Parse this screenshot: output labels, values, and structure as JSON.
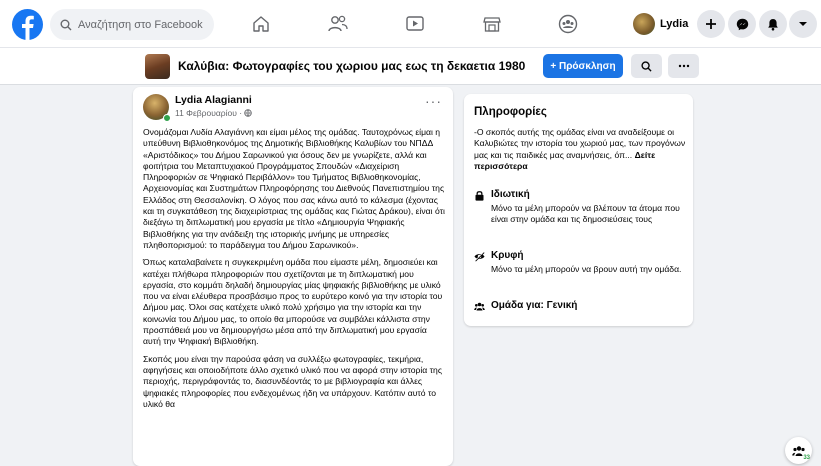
{
  "topbar": {
    "logo": "facebook-logo",
    "search_placeholder": "Αναζήτηση στο Facebook",
    "nav_icons": [
      "home-icon",
      "friends-icon",
      "watch-icon",
      "marketplace-icon",
      "groups-icon"
    ],
    "profile_name": "Lydia",
    "right_icons": [
      "plus-icon",
      "messenger-icon",
      "notifications-icon",
      "account-menu-icon"
    ]
  },
  "group": {
    "title": "Καλύβια: Φωτογραφίες του χωριου μας εως τη δεκαετια 1980",
    "invite_label": "+ Πρόσκληση"
  },
  "post": {
    "author": "Lydia Alagianni",
    "date": "11 Φεβρουαρίου · ",
    "paragraphs": [
      "Ονομάζομαι Λυδία Αλαγιάννη και είμαι μέλος της ομάδας. Ταυτοχρόνως είμαι η υπεύθυνη Βιβλιοθηκονόμος της Δημοτικής Βιβλιοθήκης Καλυβίων του ΝΠΔΔ «Αριστόδικος» του Δήμου Σαρωνικού για όσους δεν με γνωρίζετε, αλλά και φοιτήτρια του Μεταπτυχιακού Προγράμματος Σπουδών «Διαχείριση Πληροφοριών σε Ψηφιακό Περιβάλλον» του Τμήματος Βιβλιοθηκονομίας, Αρχειονομίας και Συστημάτων Πληροφόρησης του Διεθνούς Πανεπιστημίου της Ελλάδος στη Θεσσαλονίκη. Ο λόγος που σας κάνω αυτό το κάλεσμα (έχοντας και τη συγκατάθεση της διαχειρίστριας της ομάδας κας Γιώτας Δράκου), είναι ότι διεξάγω τη διπλωματική μου εργασία με τίτλο «Δημιουργία Ψηφιακής Βιβλιοθήκης για την ανάδειξη της ιστορικής μνήμης με υπηρεσίες πληθοπορισμού: το παράδειγμα του Δήμου Σαρωνικού».",
      "Όπως καταλαβαίνετε η συγκεκριμένη ομάδα που είμαστε μέλη, δημοσιεύει και κατέχει πλήθωρα πληροφοριών που σχετίζονται με τη διπλωματική μου εργασία, στο κομμάτι δηλαδή δημιουργίας μίας ψηφιακής βιβλιοθήκης με υλικό που να είναι ελέυθερα προσβάσιμο προς το ευρύτερο κοινό για την ιστορία του Δήμου μας. Όλοι σας κατέχετε υλικό πολύ χρήσιμο για την ιστορία και την κοινωνία του Δήμου μας, το οποίο θα μπορούσε να συμβάλει κάλλιστα στην προσπάθειά μου να δημιουργήσω μέσα από την διπλωματική μου εργασία αυτή την Ψηφιακή Βιβλιοθήκη.",
      "Σκοπός μου είναι την παρούσα φάση να συλλέξω φωτογραφίες, τεκμήρια, αφηγήσεις και οποιοδήποτε άλλο σχετικό υλικό που να αφορά στην ιστορία της περιοχής, περιγράφοντάς το, διασυνδέοντάς το με βιβλιογραφία και άλλες ψηφιακές πληροφορίες που ενδεχομένως ήδη να υπάρχουν. Κατόπιν αυτό το υλικό θα"
    ]
  },
  "info": {
    "title": "Πληροφορίες",
    "description": "-Ο σκοπός αυτής της ομάδας είναι να αναδείξουμε οι Καλυβιώτες την ιστορία του χωριού μας, των προγόνων μας και τις παιδικές μας αναμνήσεις, όπ... ",
    "see_more": "Δείτε περισσότερα",
    "private_title": "Ιδιωτική",
    "private_desc": "Μόνο τα μέλη μπορούν να βλέπουν τα άτομα που είναι στην ομάδα και τις δημοσιεύσεις τους",
    "hidden_title": "Κρυφή",
    "hidden_desc": "Μόνο τα μέλη μπορούν να βρουν αυτή την ομάδα.",
    "general_title": "Ομάδα για: Γενική"
  },
  "fab": {
    "badge": "33",
    "icon": "group-members-icon"
  },
  "colors": {
    "brand": "#1877f2",
    "button_blue": "#1b74e4",
    "online": "#31a24c",
    "background": "#f0f2f5"
  }
}
